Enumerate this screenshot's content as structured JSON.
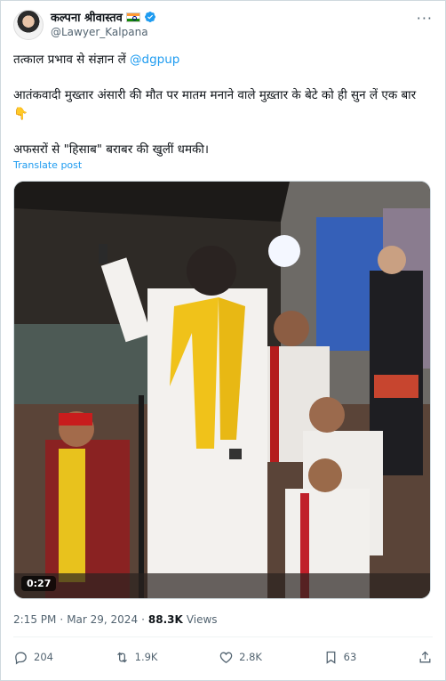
{
  "author": {
    "display_name": "कल्पना श्रीवास्तव",
    "handle": "@Lawyer_Kalpana",
    "verified": true
  },
  "tweet": {
    "line1_prefix": "तत्काल प्रभाव से संज्ञान लें ",
    "line1_mention": "@dgpup",
    "line2": "आतंकवादी मुख्तार अंसारी की मौत पर मातम मनाने वाले मुख़्तार के बेटे को ही सुन लें एक बार 👇",
    "line3": "अफसरों से \"हिसाब\" बराबर की खुलीं धमकी।",
    "translate_label": "Translate post"
  },
  "media": {
    "duration": "0:27"
  },
  "meta": {
    "time": "2:15 PM",
    "separator1": "·",
    "date": "Mar 29, 2024",
    "separator2": "·",
    "views_count": "88.3K",
    "views_label": "Views"
  },
  "actions": {
    "replies": "204",
    "reposts": "1.9K",
    "likes": "2.8K",
    "bookmarks": "63"
  }
}
